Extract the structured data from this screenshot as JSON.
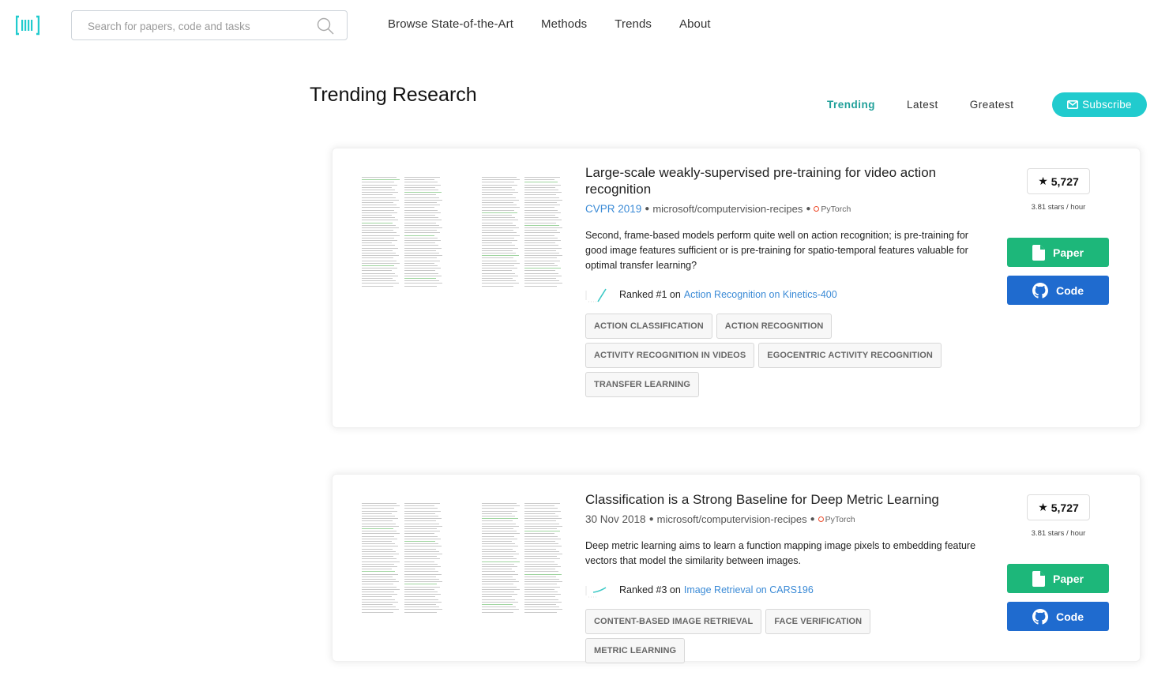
{
  "navbar": {
    "logo": "paperswithcode-logo",
    "search_placeholder": "Search for papers, code and tasks",
    "search_value": "",
    "links": [
      "Browse State-of-the-Art",
      "Methods",
      "Trends",
      "About"
    ]
  },
  "header": {
    "title": "Trending Research",
    "tabs": [
      {
        "label": "Trending",
        "active": true
      },
      {
        "label": "Latest",
        "active": false
      },
      {
        "label": "Greatest",
        "active": false
      }
    ],
    "subscribe_label": "Subscribe"
  },
  "colors": {
    "accent": "#21cbce",
    "active_tab": "#21a09a",
    "paper_button": "#1db77a",
    "code_button": "#1f6bcf",
    "link": "#3a8ad6",
    "pytorch": "#ee4c2c"
  },
  "papers": [
    {
      "title": "Large-scale weakly-supervised pre-training for video action recognition",
      "venue": "CVPR 2019",
      "repo": "microsoft/computervision-recipes",
      "framework": "PyTorch",
      "abstract": "Second, frame-based models perform quite well on action recognition; is pre-training for good image features sufficient or is pre-training for spatio-temporal features valuable for optimal transfer learning?",
      "rank_prefix": "Ranked #1 on",
      "rank_task": "Action Recognition on Kinetics-400",
      "tags": [
        "ACTION CLASSIFICATION",
        "ACTION RECOGNITION",
        "ACTIVITY RECOGNITION IN VIDEOS",
        "EGOCENTRIC ACTIVITY RECOGNITION",
        "TRANSFER LEARNING"
      ],
      "stars": "5,727",
      "rate": "3.81 stars / hour",
      "paper_label": "Paper",
      "code_label": "Code"
    },
    {
      "title": "Classification is a Strong Baseline for Deep Metric Learning",
      "date": "30 Nov 2018",
      "repo": "microsoft/computervision-recipes",
      "framework": "PyTorch",
      "abstract": "Deep metric learning aims to learn a function mapping image pixels to embedding feature vectors that model the similarity between images.",
      "rank_prefix": "Ranked #3 on",
      "rank_task": "Image Retrieval on CARS196",
      "tags": [
        "CONTENT-BASED IMAGE RETRIEVAL",
        "FACE VERIFICATION",
        "METRIC LEARNING"
      ],
      "stars": "5,727",
      "rate": "3.81 stars / hour",
      "paper_label": "Paper",
      "code_label": "Code"
    }
  ]
}
